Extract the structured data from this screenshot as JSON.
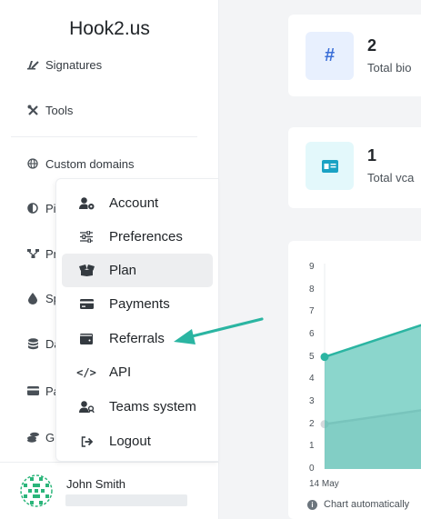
{
  "brand": "Hook2.us",
  "sidebar": {
    "items": [
      {
        "label": "Signatures",
        "icon": "signature-icon"
      },
      {
        "label": "Tools",
        "icon": "tools-icon"
      },
      {
        "label": "Custom domains",
        "icon": "globe-icon"
      },
      {
        "label": "Pi",
        "icon": "adjust-icon"
      },
      {
        "label": "Pr",
        "icon": "network-icon"
      },
      {
        "label": "Sp",
        "icon": "drop-icon"
      },
      {
        "label": "Da",
        "icon": "database-icon"
      },
      {
        "label": "Pa",
        "icon": "credit-card-icon"
      },
      {
        "label": "Gu",
        "icon": "coins-icon"
      }
    ]
  },
  "user": {
    "name": "John Smith"
  },
  "menu": {
    "items": [
      {
        "label": "Account",
        "icon": "user-cog-icon"
      },
      {
        "label": "Preferences",
        "icon": "sliders-icon"
      },
      {
        "label": "Plan",
        "icon": "box-open-icon"
      },
      {
        "label": "Payments",
        "icon": "credit-card-icon"
      },
      {
        "label": "Referrals",
        "icon": "wallet-icon"
      },
      {
        "label": "API",
        "icon": "code-icon"
      },
      {
        "label": "Teams system",
        "icon": "users-icon"
      },
      {
        "label": "Logout",
        "icon": "sign-out-icon"
      }
    ],
    "active": "Plan"
  },
  "stats": [
    {
      "value": "2",
      "label": "Total bio",
      "icon": "hash-icon"
    },
    {
      "value": "1",
      "label": "Total vca",
      "icon": "id-card-icon"
    }
  ],
  "chart_data": {
    "type": "area",
    "title": "",
    "xlabel": "",
    "ylabel": "",
    "ylim": [
      0,
      9
    ],
    "yticks": [
      "0",
      "1",
      "2",
      "3",
      "4",
      "5",
      "6",
      "7",
      "8",
      "9"
    ],
    "categories": [
      "14 May"
    ],
    "series": [
      {
        "values": [
          5,
          6.6
        ],
        "color": "#2bb5a2"
      },
      {
        "values": [
          2,
          2.7
        ],
        "color": "#d5d8dc"
      }
    ],
    "note": "Chart automatically"
  },
  "colors": {
    "accent": "#2bb5a2",
    "arrow": "#2bb5a2",
    "hash_bg": "#e8f0fe",
    "hash_fg": "#3b6fd8",
    "card_bg": "#e3f8fb",
    "card_fg": "#1aa2c4"
  }
}
